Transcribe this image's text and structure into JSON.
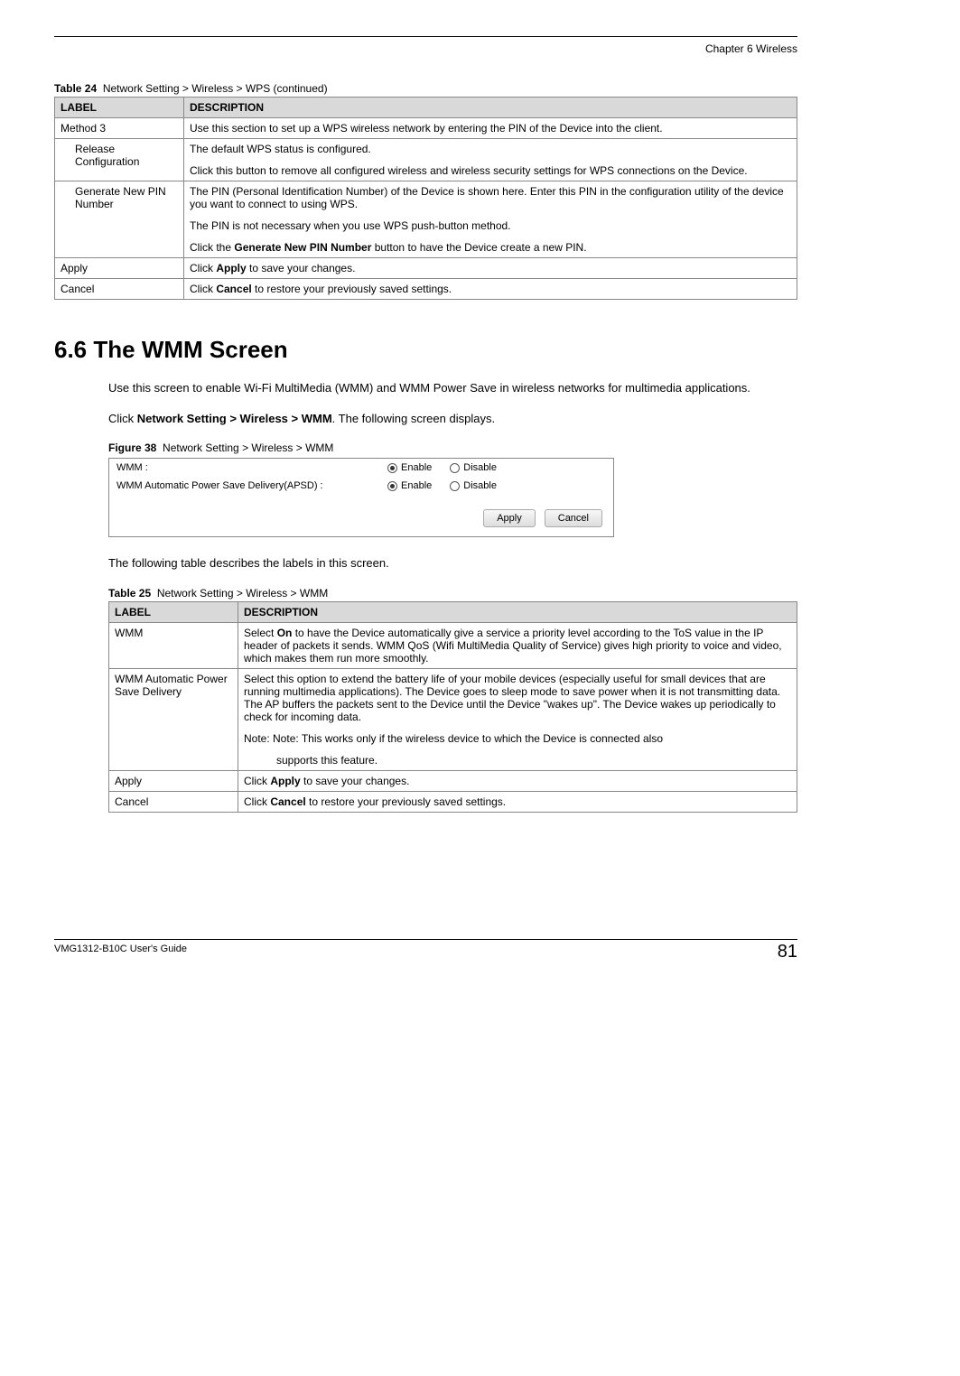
{
  "header": {
    "chapter": "Chapter 6 Wireless"
  },
  "table24": {
    "caption_prefix": "Table 24",
    "caption_text": "Network Setting > Wireless > WPS (continued)",
    "head_label": "LABEL",
    "head_desc": "DESCRIPTION",
    "rows": {
      "method3": {
        "label": "Method 3",
        "desc": "Use this section to set up a WPS wireless network by entering the PIN of the Device into the client."
      },
      "release": {
        "label": "Release Configuration",
        "p1": "The default WPS status is configured.",
        "p2": "Click this button to remove all configured wireless and wireless security settings for WPS connections on the Device."
      },
      "generate": {
        "label": "Generate New PIN Number",
        "p1": "The PIN (Personal Identification Number) of the Device is shown here. Enter this PIN in the configuration utility of the device you want to connect to using WPS.",
        "p2": "The PIN is not necessary when you use WPS push-button method.",
        "p3a": "Click the ",
        "p3b": "Generate New PIN Number",
        "p3c": " button to have the Device create a new PIN."
      },
      "apply": {
        "label": "Apply",
        "d1": "Click ",
        "d2": "Apply",
        "d3": " to save your changes."
      },
      "cancel": {
        "label": "Cancel",
        "d1": "Click ",
        "d2": "Cancel",
        "d3": " to restore your previously saved settings."
      }
    }
  },
  "section": {
    "heading": "6.6  The WMM Screen",
    "para1": "Use this screen to enable Wi-Fi MultiMedia (WMM) and WMM Power Save in wireless networks for multimedia applications.",
    "para2a": "Click ",
    "para2b": "Network Setting > Wireless > WMM",
    "para2c": ". The following screen displays."
  },
  "figure38": {
    "caption_prefix": "Figure 38",
    "caption_text": "Network Setting > Wireless > WMM",
    "row1_label": "WMM :",
    "row2_label": "WMM Automatic Power Save Delivery(APSD) :",
    "opt_enable": "Enable",
    "opt_disable": "Disable",
    "btn_apply": "Apply",
    "btn_cancel": "Cancel"
  },
  "after_figure": "The following table describes the labels in this screen.",
  "table25": {
    "caption_prefix": "Table 25",
    "caption_text": "Network Setting > Wireless > WMM",
    "head_label": "LABEL",
    "head_desc": "DESCRIPTION",
    "rows": {
      "wmm": {
        "label": "WMM",
        "d1": "Select ",
        "d2": "On",
        "d3": " to have the Device automatically give a service a priority level according to the ToS value in the IP header of packets it sends. WMM QoS (Wifi MultiMedia Quality of Service) gives high priority to voice and video, which makes them run more smoothly."
      },
      "apsd": {
        "label": "WMM Automatic Power Save Delivery",
        "p1": "Select this option to extend the battery life of your mobile devices (especially useful for small devices that are running multimedia applications). The Device goes to sleep mode to save power when it is not transmitting data. The AP buffers the packets sent to the Device until the Device \"wakes up\". The Device wakes up periodically to check for incoming data.",
        "note1": "Note: Note: This works only if the wireless device to which the Device is connected also",
        "note2": "supports this feature."
      },
      "apply": {
        "label": "Apply",
        "d1": "Click ",
        "d2": "Apply",
        "d3": " to save your changes."
      },
      "cancel": {
        "label": "Cancel",
        "d1": "Click ",
        "d2": "Cancel",
        "d3": " to restore your previously saved settings."
      }
    }
  },
  "footer": {
    "guide": "VMG1312-B10C User's Guide",
    "page": "81"
  }
}
